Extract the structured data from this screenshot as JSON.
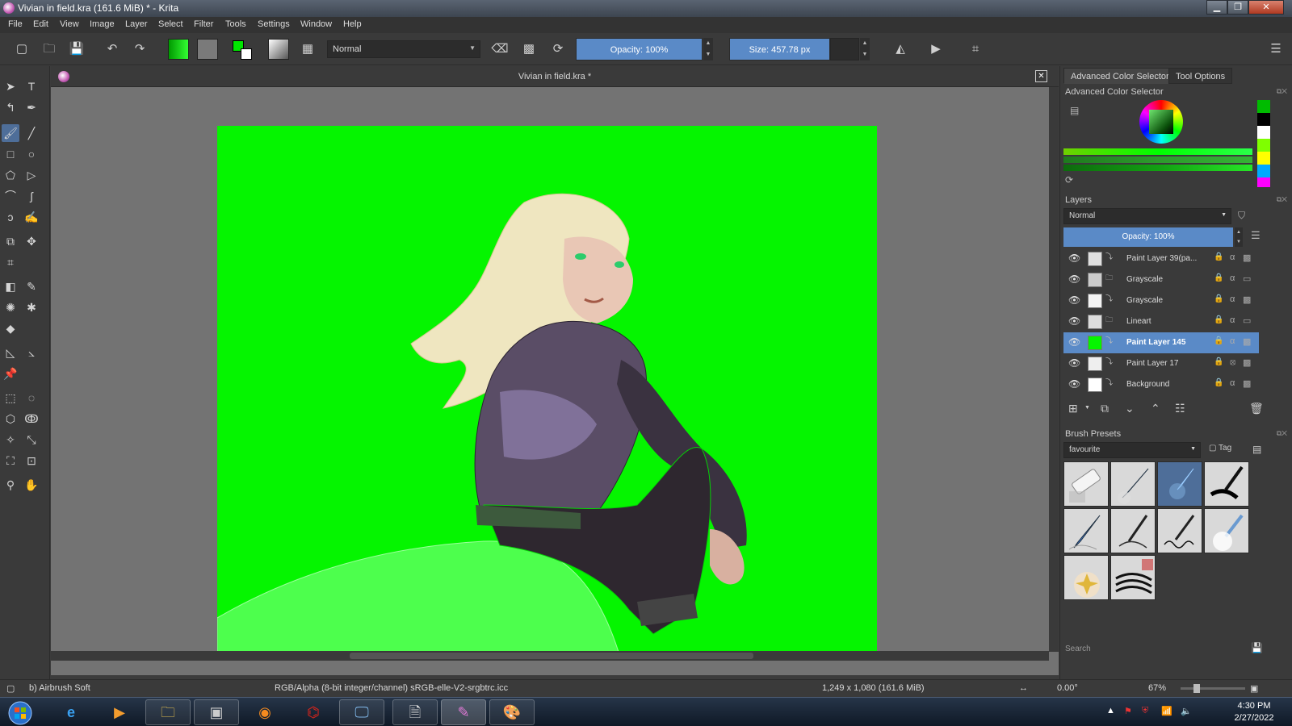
{
  "window": {
    "title": "Vivian in field.kra (161.6 MiB)  * - Krita",
    "minimize": "▁",
    "maximize": "❐",
    "close": "✕"
  },
  "menu": [
    "File",
    "Edit",
    "View",
    "Image",
    "Layer",
    "Select",
    "Filter",
    "Tools",
    "Settings",
    "Window",
    "Help"
  ],
  "toolbar": {
    "blend_mode": "Normal",
    "opacity_label": "Opacity: 100%",
    "size_label": "Size: 457.78 px",
    "fg_color": "#00e600",
    "bg_color": "#ffffff"
  },
  "document": {
    "tab_title": "Vivian in field.kra *",
    "canvas_color": "#05f500"
  },
  "dock": {
    "tabs": [
      "Advanced Color Selector",
      "Tool Options"
    ],
    "acs_title": "Advanced Color Selector",
    "layers_title": "Layers",
    "layers_blend": "Normal",
    "layers_opacity": "Opacity:  100%",
    "layers": [
      {
        "name": "Paint Layer 39(pa...",
        "selected": false
      },
      {
        "name": "Grayscale",
        "selected": false
      },
      {
        "name": "Grayscale",
        "selected": false
      },
      {
        "name": "Lineart",
        "selected": false
      },
      {
        "name": "Paint Layer 145",
        "selected": true
      },
      {
        "name": "Paint Layer 17",
        "selected": false
      },
      {
        "name": "Background",
        "selected": false
      }
    ],
    "brush_presets_title": "Brush Presets",
    "brush_tag": "favourite",
    "tag_label": "Tag",
    "search_placeholder": "Search"
  },
  "statusbar": {
    "brush": "b) Airbrush Soft",
    "colorspace": "RGB/Alpha (8-bit integer/channel)  sRGB-elle-V2-srgbtrc.icc",
    "dimensions": "1,249 x 1,080 (161.6 MiB)",
    "rotation": "0.00°",
    "zoom": "67%"
  },
  "taskbar": {
    "time": "4:30 PM",
    "date": "2/27/2022"
  }
}
